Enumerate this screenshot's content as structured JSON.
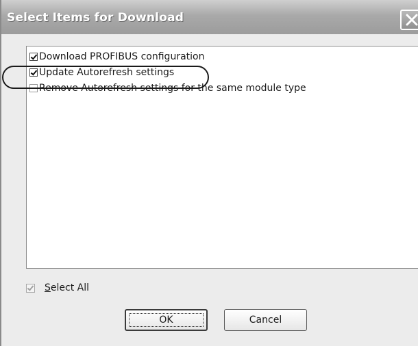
{
  "window": {
    "title": "Select Items for Download"
  },
  "items": [
    {
      "label": "Download PROFIBUS configuration",
      "checked": true
    },
    {
      "label": "Update Autorefresh settings",
      "checked": true
    },
    {
      "label": "Remove Autorefresh settings for the same module type",
      "checked": false
    }
  ],
  "select_all": {
    "accel": "S",
    "rest": "elect All",
    "checked": true,
    "enabled": false
  },
  "buttons": {
    "ok_label": "OK",
    "cancel_label": "Cancel"
  },
  "icons": {
    "close": "close-icon"
  }
}
